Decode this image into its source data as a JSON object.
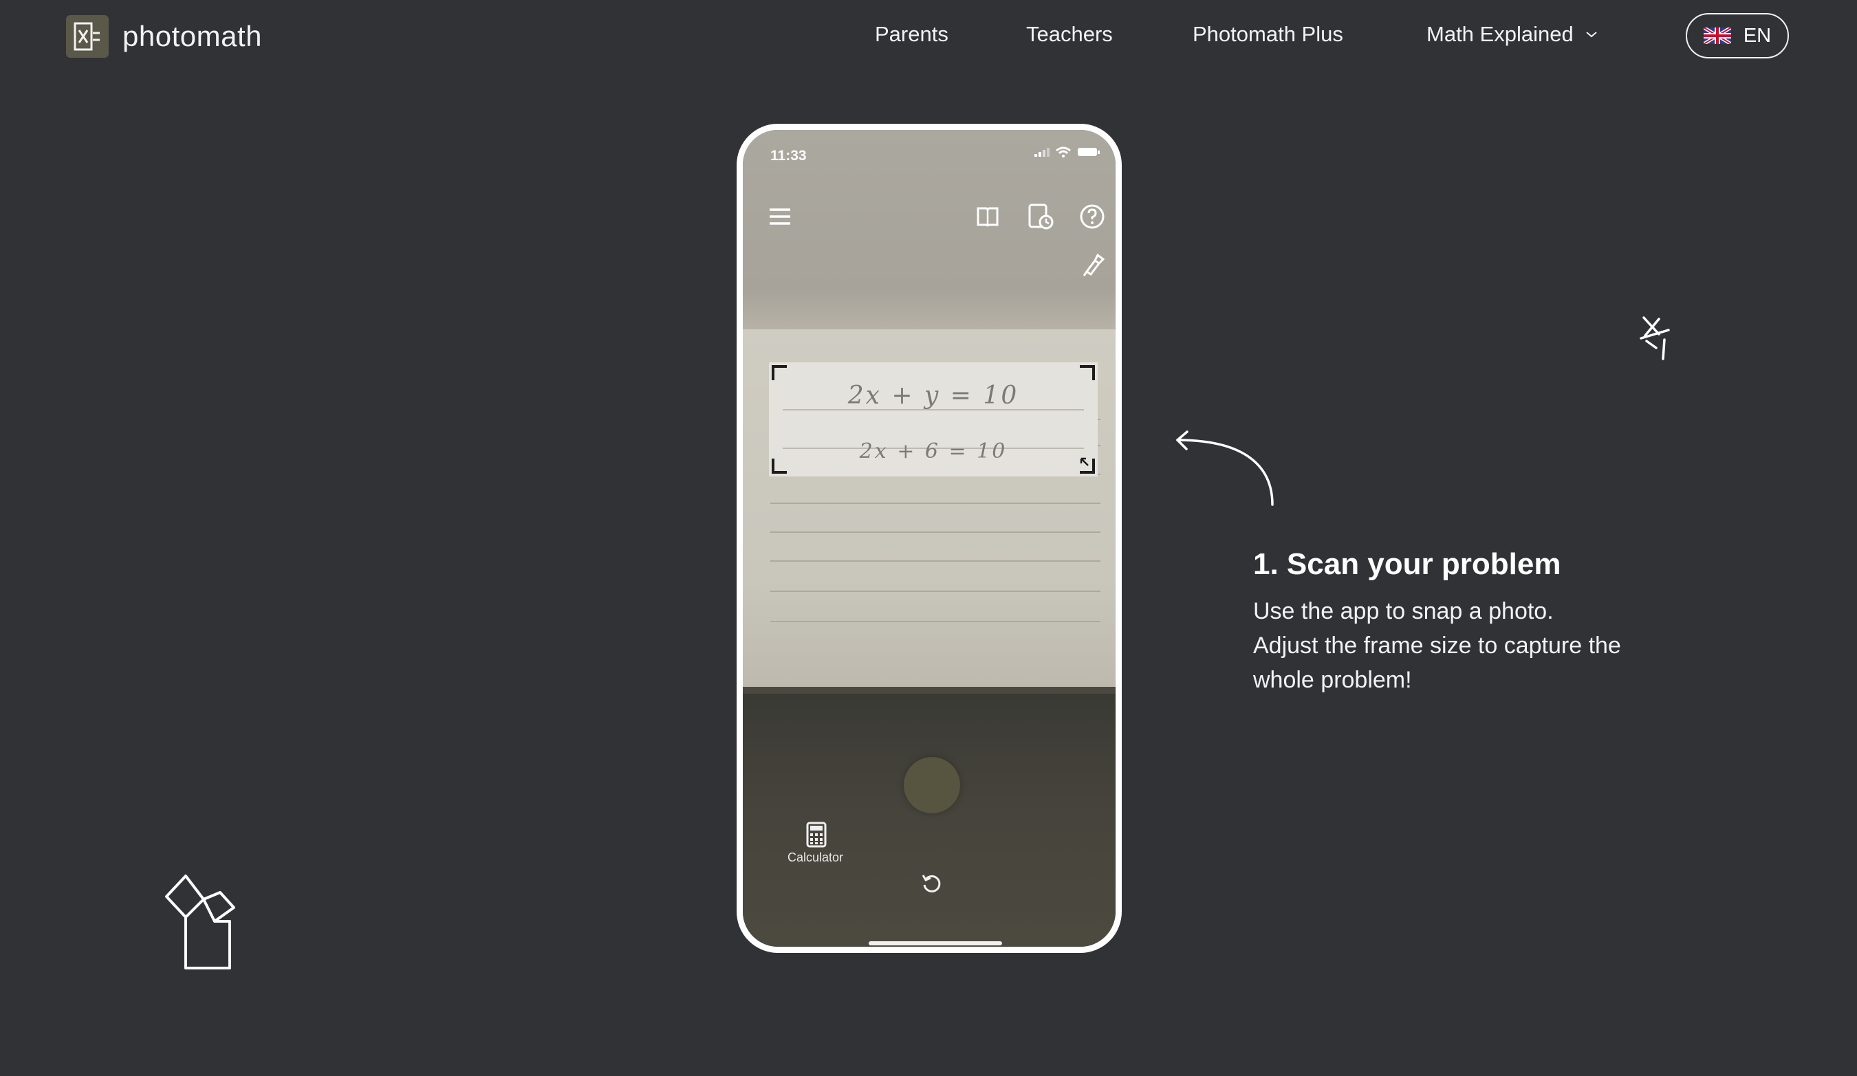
{
  "header": {
    "logo_text": "photomath",
    "logo_icon": "x-equals-logo-icon",
    "nav": [
      {
        "label": "Parents"
      },
      {
        "label": "Teachers"
      },
      {
        "label": "Photomath Plus"
      },
      {
        "label": "Math Explained",
        "has_dropdown": true
      }
    ],
    "language": {
      "label": "EN",
      "flag_icon": "uk-flag-icon"
    }
  },
  "phone": {
    "time": "11:33",
    "top_icons": [
      "menu-icon",
      "book-icon",
      "history-icon",
      "help-icon",
      "flashlight-icon"
    ],
    "scanned_problem": {
      "line1": "2x + y = 10",
      "line2": "2x + 6 = 10"
    },
    "calculator_label": "Calculator",
    "bottom_icons": [
      "calculator-icon",
      "shutter-button",
      "rotate-icon"
    ]
  },
  "step": {
    "title": "1. Scan your problem",
    "lines": [
      "Use the app to snap a photo.",
      "Adjust the frame size to capture the",
      "whole problem!"
    ]
  },
  "colors": {
    "background": "#313236",
    "text": "#ffffff",
    "phone_frame": "#ffffff"
  }
}
